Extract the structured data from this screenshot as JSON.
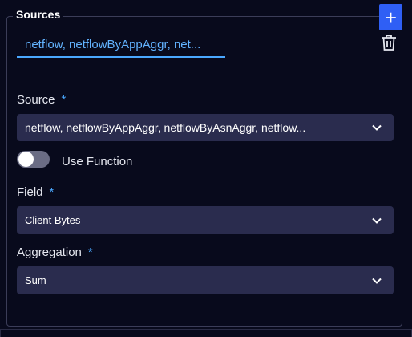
{
  "panel": {
    "title": "Sources",
    "add_label": "+",
    "name_value": "netflow, netflowByAppAggr, net..."
  },
  "source": {
    "label": "Source",
    "required_mark": "*",
    "value": "netflow, netflowByAppAggr, netflowByAsnAggr, netflow..."
  },
  "use_function": {
    "label": "Use Function",
    "enabled": false
  },
  "field": {
    "label": "Field",
    "required_mark": "*",
    "value": "Client Bytes"
  },
  "aggregation": {
    "label": "Aggregation",
    "required_mark": "*",
    "value": "Sum"
  },
  "icons": {
    "add": "plus-icon",
    "delete": "trash-icon",
    "dropdown": "chevron-down-icon"
  },
  "colors": {
    "background": "#080a1c",
    "accent": "#2f5ff5",
    "input_text": "#63b3ff",
    "select_bg": "#2a2c4e"
  }
}
